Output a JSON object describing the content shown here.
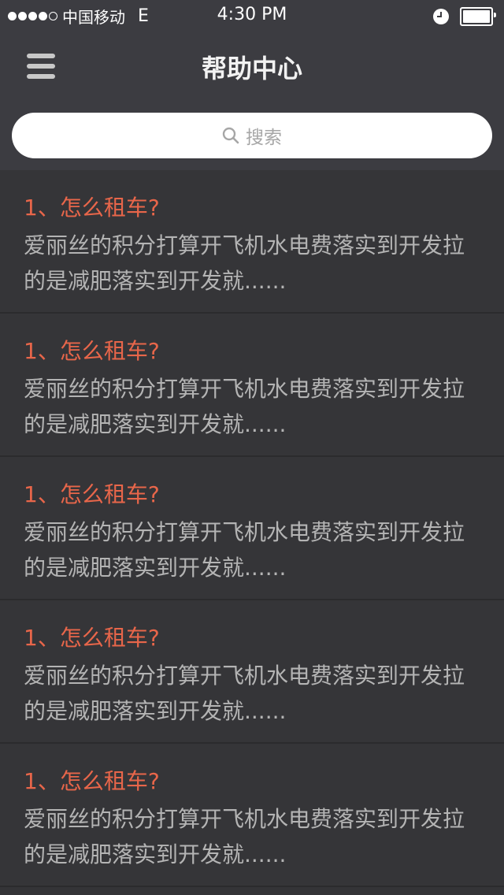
{
  "status_bar": {
    "carrier": "中国移动",
    "network": "E",
    "time": "4:30 PM",
    "signal_filled": 4,
    "signal_total": 5
  },
  "nav": {
    "title": "帮助中心",
    "menu_icon": "hamburger-menu-icon"
  },
  "search": {
    "placeholder": "搜索",
    "icon": "search-icon"
  },
  "faq_items": [
    {
      "title": "1、怎么租车?",
      "body": "爱丽丝的积分打算开飞机水电费落实到开发拉的是减肥落实到开发就......"
    },
    {
      "title": "1、怎么租车?",
      "body": "爱丽丝的积分打算开飞机水电费落实到开发拉的是减肥落实到开发就......"
    },
    {
      "title": "1、怎么租车?",
      "body": "爱丽丝的积分打算开飞机水电费落实到开发拉的是减肥落实到开发就......"
    },
    {
      "title": "1、怎么租车?",
      "body": "爱丽丝的积分打算开飞机水电费落实到开发拉的是减肥落实到开发就......"
    },
    {
      "title": "1、怎么租车?",
      "body": "爱丽丝的积分打算开飞机水电费落实到开发拉的是减肥落实到开发就......"
    }
  ],
  "colors": {
    "accent": "#e8664a",
    "background": "#353538",
    "header": "#3c3c41",
    "body_text": "#b4b4b4"
  }
}
